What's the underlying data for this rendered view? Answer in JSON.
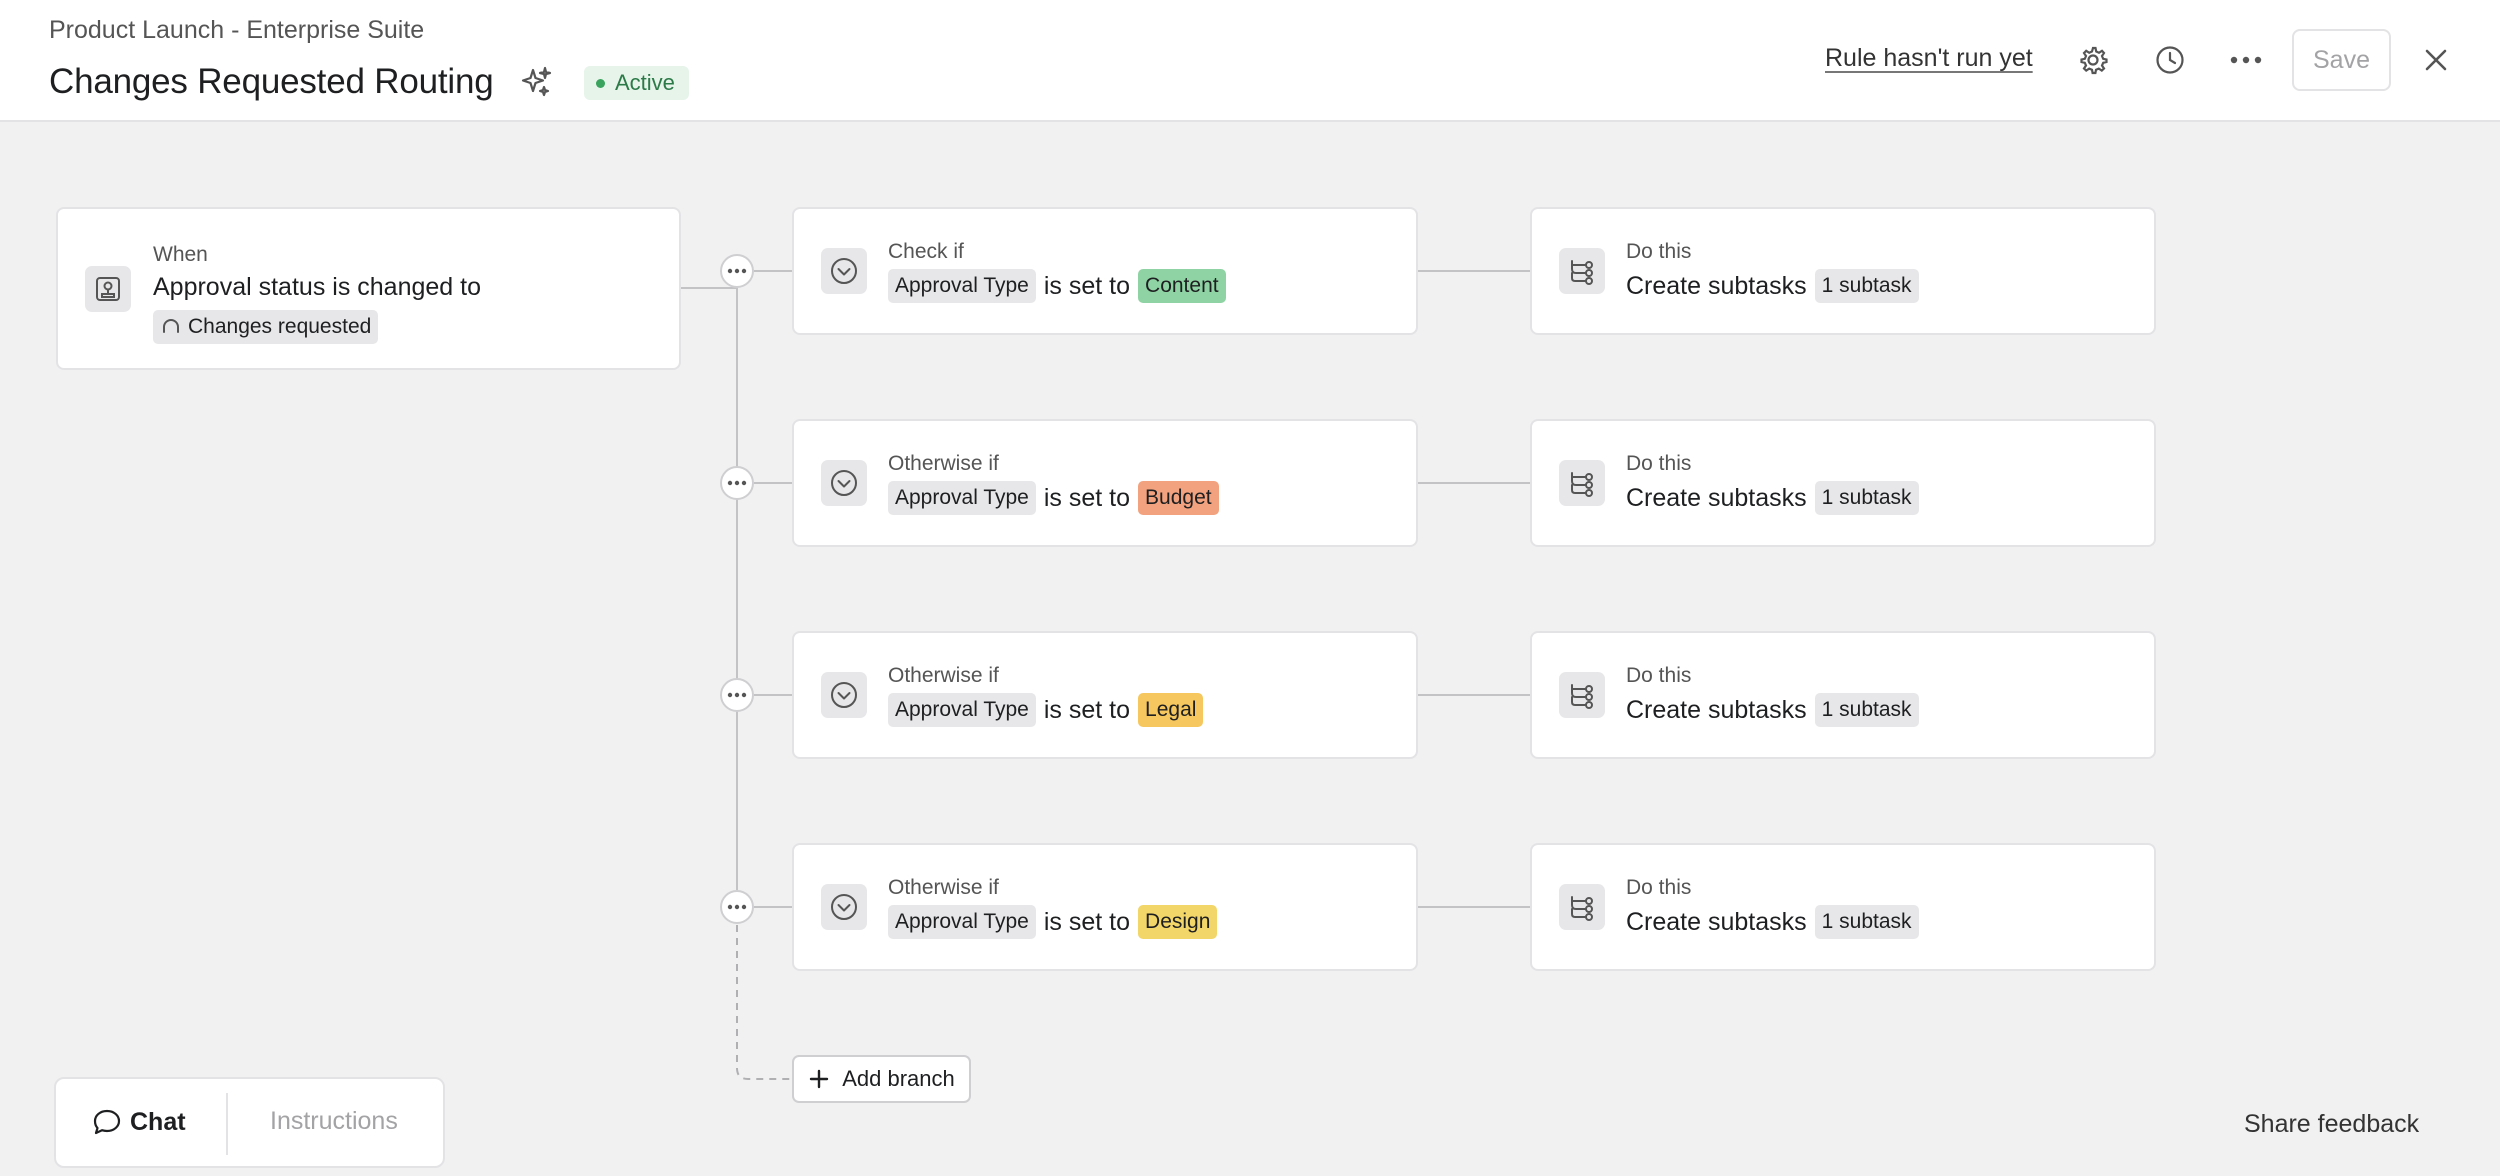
{
  "header": {
    "breadcrumb": "Product Launch - Enterprise Suite",
    "title": "Changes Requested Routing",
    "status": "Active",
    "run_status": "Rule hasn't run yet",
    "save_label": "Save"
  },
  "trigger": {
    "label": "When",
    "text": "Approval status is changed to",
    "value": "Changes requested"
  },
  "conditions": [
    {
      "label": "Check if",
      "field": "Approval Type",
      "op": "is set to",
      "value": "Content",
      "color": "#8fd3a4"
    },
    {
      "label": "Otherwise if",
      "field": "Approval Type",
      "op": "is set to",
      "value": "Budget",
      "color": "#f2a27e"
    },
    {
      "label": "Otherwise if",
      "field": "Approval Type",
      "op": "is set to",
      "value": "Legal",
      "color": "#f6c75f"
    },
    {
      "label": "Otherwise if",
      "field": "Approval Type",
      "op": "is set to",
      "value": "Design",
      "color": "#f3d669"
    }
  ],
  "actions": [
    {
      "label": "Do this",
      "text": "Create subtasks",
      "badge": "1 subtask"
    },
    {
      "label": "Do this",
      "text": "Create subtasks",
      "badge": "1 subtask"
    },
    {
      "label": "Do this",
      "text": "Create subtasks",
      "badge": "1 subtask"
    },
    {
      "label": "Do this",
      "text": "Create subtasks",
      "badge": "1 subtask"
    }
  ],
  "add_branch_label": "Add branch",
  "bottom": {
    "chat_label": "Chat",
    "instructions_label": "Instructions",
    "share_feedback": "Share feedback"
  }
}
